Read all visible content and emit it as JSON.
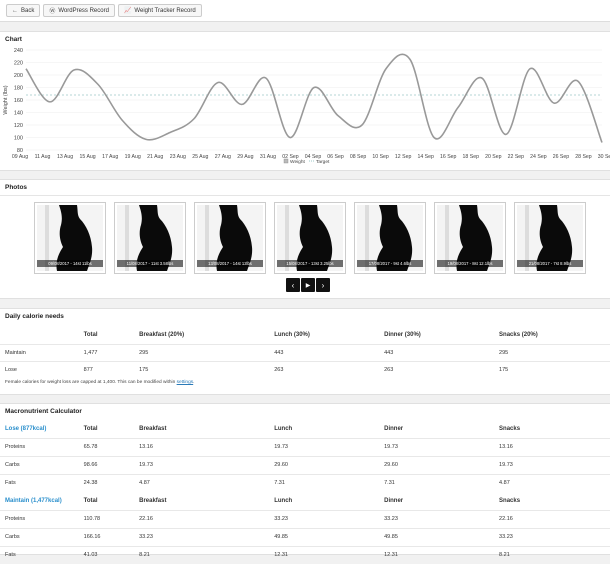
{
  "toolbar": {
    "back_label": "Back",
    "wp_label": "WordPress Record",
    "wt_label": "Weight Tracker Record"
  },
  "chart_section": {
    "title": "Chart"
  },
  "chart_data": {
    "type": "line",
    "ylabel": "Weight (lbs)",
    "ylim": [
      80,
      240
    ],
    "yticks": [
      80,
      100,
      120,
      140,
      160,
      180,
      200,
      220,
      240
    ],
    "categories": [
      "09 Aug",
      "11 Aug",
      "13 Aug",
      "15 Aug",
      "17 Aug",
      "19 Aug",
      "21 Aug",
      "23 Aug",
      "25 Aug",
      "27 Aug",
      "29 Aug",
      "31 Aug",
      "02 Sep",
      "04 Sep",
      "06 Sep",
      "08 Sep",
      "10 Sep",
      "12 Sep",
      "14 Sep",
      "16 Sep",
      "18 Sep",
      "20 Sep",
      "22 Sep",
      "24 Sep",
      "26 Sep",
      "28 Sep",
      "30 Sep"
    ],
    "series": [
      {
        "name": "Weight",
        "color": "#999999",
        "values": [
          210,
          157,
          208,
          185,
          128,
          97,
          108,
          130,
          188,
          153,
          195,
          100,
          180,
          135,
          120,
          210,
          225,
          100,
          148,
          195,
          105,
          210,
          155,
          190,
          92
        ]
      },
      {
        "name": "Target",
        "color": "#9ec9c9",
        "constant": 168
      }
    ],
    "legend": [
      "Weight",
      "Target"
    ],
    "legend_position": "bottom"
  },
  "photos_section": {
    "title": "Photos",
    "photos": [
      {
        "caption": "09/08/2017 - 14st 11lbs"
      },
      {
        "caption": "11/08/2017 - 11st 3.58lbs"
      },
      {
        "caption": "13/08/2017 - 14st 12lbs"
      },
      {
        "caption": "15/08/2017 - 13st 3.25lbs"
      },
      {
        "caption": "17/08/2017 - 9st 4.6lbs"
      },
      {
        "caption": "19/08/2017 - 8st 12.1lbs"
      },
      {
        "caption": "21/08/2017 - 7st 8.9lbs"
      }
    ],
    "prev_icon": "‹",
    "play_icon": "▶",
    "next_icon": "›"
  },
  "calorie_section": {
    "title": "Daily calorie needs",
    "headers": [
      "",
      "Total",
      "Breakfast (20%)",
      "Lunch (30%)",
      "Dinner (30%)",
      "Snacks (20%)"
    ],
    "rows": [
      [
        "Maintain",
        "1,477",
        "295",
        "443",
        "443",
        "295"
      ],
      [
        "Lose",
        "877",
        "175",
        "263",
        "263",
        "175"
      ]
    ],
    "note": "Female calories for weight loss are capped at 1,400. This can be modified within ",
    "note_link": "settings"
  },
  "macro_section": {
    "title": "Macronutrient Calculator",
    "lose_header": [
      "Lose (877kcal)",
      "Total",
      "Breakfast",
      "Lunch",
      "Dinner",
      "Snacks"
    ],
    "lose_rows": [
      [
        "Proteins",
        "65.78",
        "13.16",
        "19.73",
        "19.73",
        "13.16"
      ],
      [
        "Carbs",
        "98.66",
        "19.73",
        "29.60",
        "29.60",
        "19.73"
      ],
      [
        "Fats",
        "24.38",
        "4.87",
        "7.31",
        "7.31",
        "4.87"
      ]
    ],
    "maintain_header": [
      "Maintain (1,477kcal)",
      "Total",
      "Breakfast",
      "Lunch",
      "Dinner",
      "Snacks"
    ],
    "maintain_rows": [
      [
        "Proteins",
        "110.78",
        "22.16",
        "33.23",
        "33.23",
        "22.16"
      ],
      [
        "Carbs",
        "166.16",
        "33.23",
        "49.85",
        "49.85",
        "33.23"
      ],
      [
        "Fats",
        "41.03",
        "8.21",
        "12.31",
        "12.31",
        "8.21"
      ]
    ]
  }
}
